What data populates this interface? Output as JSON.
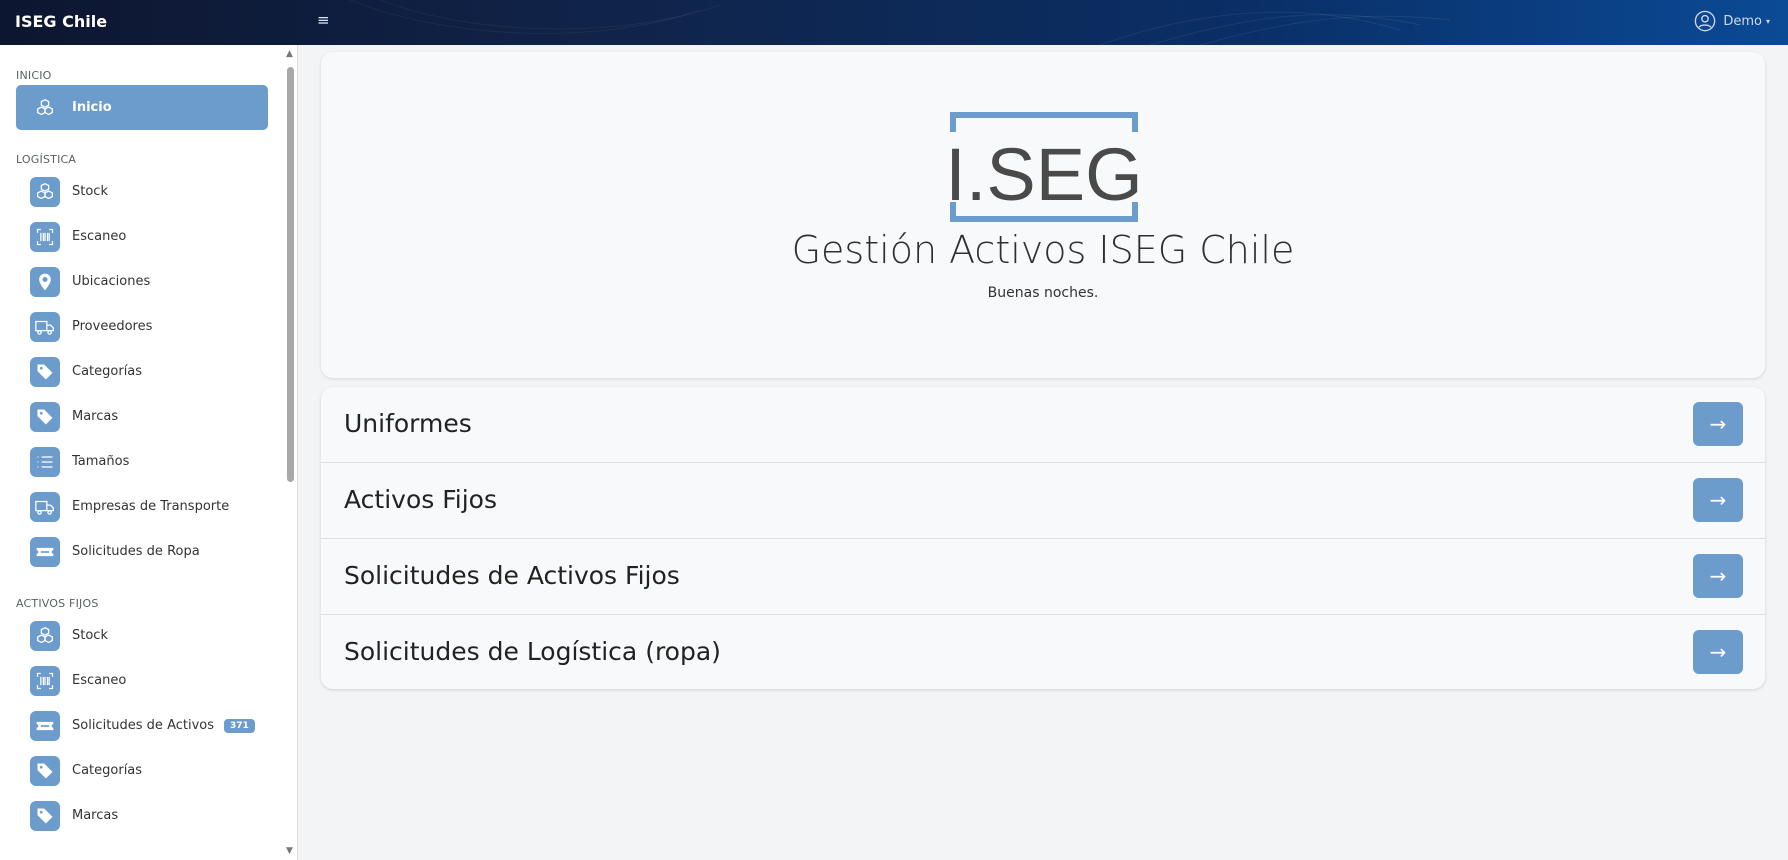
{
  "app": {
    "brand": "ISEG Chile"
  },
  "topbar": {
    "menu_glyph": "≡",
    "user_name": "Demo",
    "caret": "▾"
  },
  "sidebar": {
    "sections": [
      {
        "label": "INICIO",
        "items": [
          {
            "label": "Inicio",
            "icon": "cubes-icon",
            "active": true
          }
        ]
      },
      {
        "label": "LOGÍSTICA",
        "items": [
          {
            "label": "Stock",
            "icon": "cubes-icon"
          },
          {
            "label": "Escaneo",
            "icon": "barcode-scan-icon"
          },
          {
            "label": "Ubicaciones",
            "icon": "map-pin-icon"
          },
          {
            "label": "Proveedores",
            "icon": "truck-icon"
          },
          {
            "label": "Categorías",
            "icon": "tag-icon"
          },
          {
            "label": "Marcas",
            "icon": "tags-icon"
          },
          {
            "label": "Tamaños",
            "icon": "list-icon"
          },
          {
            "label": "Empresas de Transporte",
            "icon": "truck-icon"
          },
          {
            "label": "Solicitudes de Ropa",
            "icon": "ticket-icon"
          }
        ]
      },
      {
        "label": "ACTIVOS FIJOS",
        "items": [
          {
            "label": "Stock",
            "icon": "cubes-icon"
          },
          {
            "label": "Escaneo",
            "icon": "barcode-scan-icon"
          },
          {
            "label": "Solicitudes de Activos",
            "icon": "ticket-icon",
            "badge": "371"
          },
          {
            "label": "Categorías",
            "icon": "tag-icon"
          },
          {
            "label": "Marcas",
            "icon": "tags-icon"
          }
        ]
      }
    ]
  },
  "hero": {
    "logo_text": "I.SEG",
    "title": "Gestión Activos ISEG Chile",
    "subtitle": "Buenas noches."
  },
  "modules": [
    {
      "name": "Uniformes",
      "arrow": "→"
    },
    {
      "name": "Activos Fijos",
      "arrow": "→"
    },
    {
      "name": "Solicitudes de Activos Fijos",
      "arrow": "→"
    },
    {
      "name": "Solicitudes de Logística (ropa)",
      "arrow": "→"
    }
  ],
  "colors": {
    "accent": "#6b9ccb",
    "logo_gray": "#4a4a4a"
  }
}
